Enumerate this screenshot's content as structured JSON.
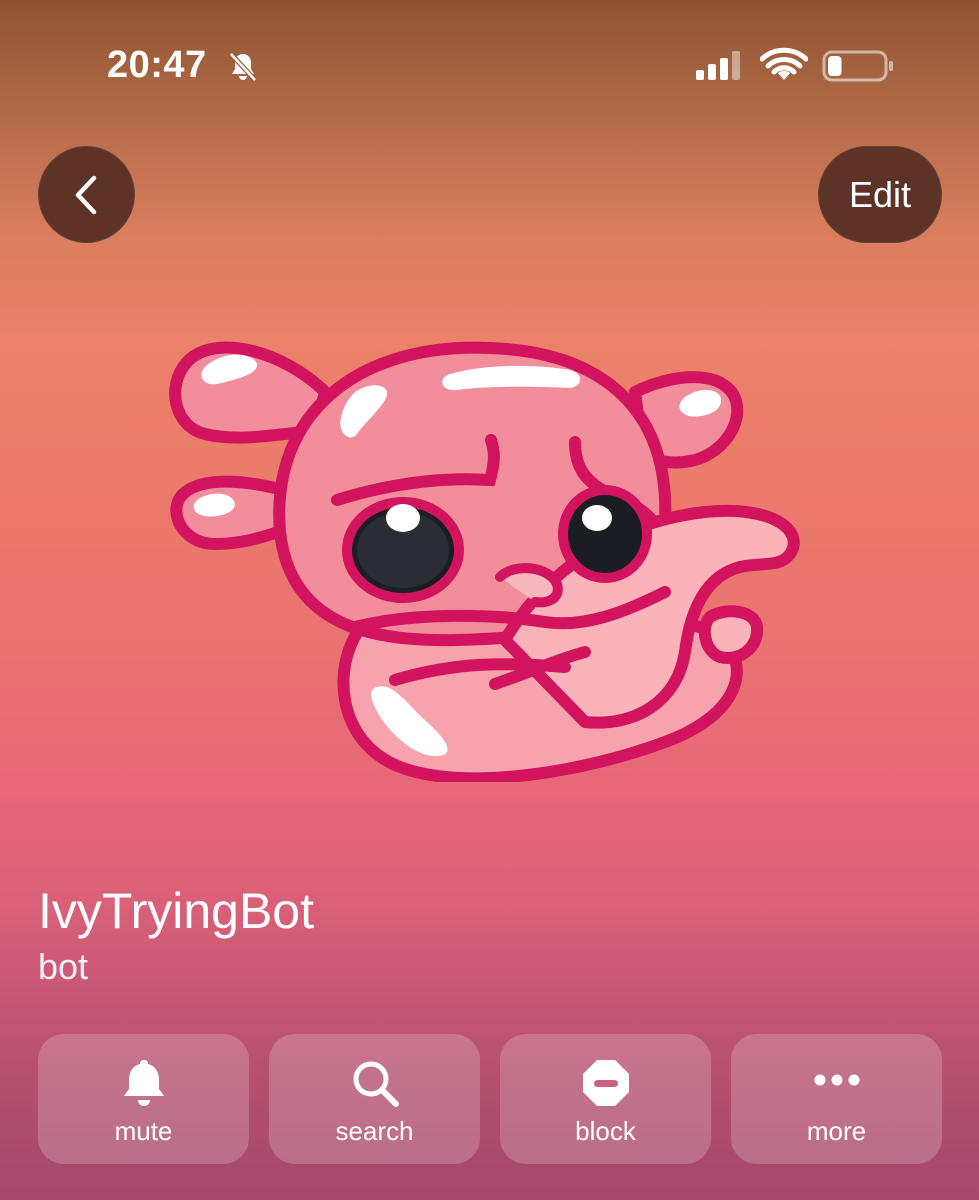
{
  "status_bar": {
    "time": "20:47",
    "silent_icon": "bell-slash-icon",
    "signal_icon": "cellular-signal-icon",
    "wifi_icon": "wifi-icon",
    "battery_icon": "battery-icon",
    "battery_level": 0.25
  },
  "nav": {
    "back_icon": "chevron-left-icon",
    "edit_label": "Edit"
  },
  "profile": {
    "avatar": "pink-axolotl-sticker",
    "name": "IvyTryingBot",
    "subtitle": "bot"
  },
  "actions": [
    {
      "label": "mute",
      "icon": "bell-icon"
    },
    {
      "label": "search",
      "icon": "search-icon"
    },
    {
      "label": "block",
      "icon": "block-icon"
    },
    {
      "label": "more",
      "icon": "more-icon"
    }
  ],
  "colors": {
    "button_dark": "#5c3326",
    "outline_magenta": "#d2135e",
    "body_pink": "#f28d9c",
    "header_brown": "#8e5230"
  }
}
